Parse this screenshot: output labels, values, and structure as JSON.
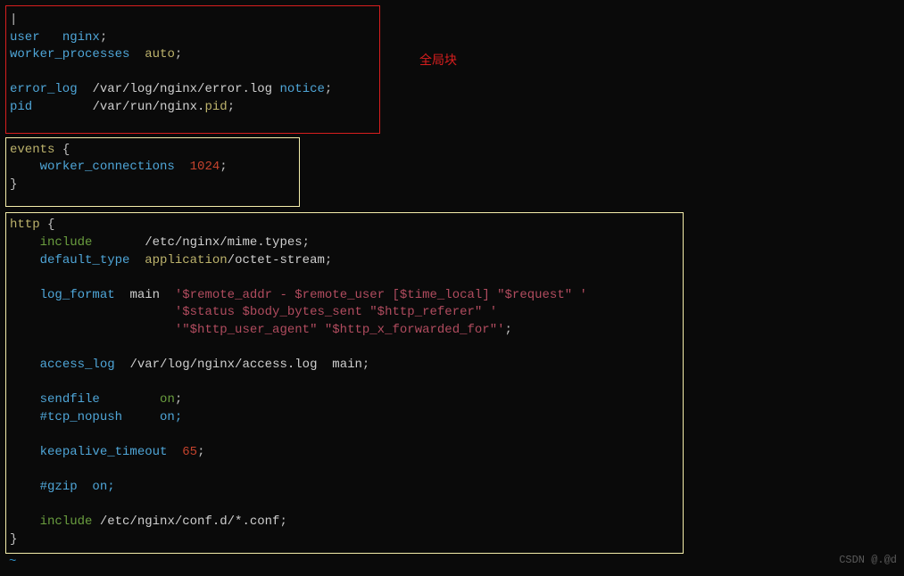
{
  "annotation": {
    "global_block": "全局块"
  },
  "global": {
    "l1_kw1": "user",
    "l1_kw2": "nginx",
    "l2_kw": "worker_processes",
    "l2_val": "auto",
    "l3_kw": "error_log",
    "l3_path": "/var/log/nginx/error.log",
    "l3_lvl": "notice",
    "l4_kw": "pid",
    "l4_path": "/var/run/nginx.",
    "l4_ext": "pid"
  },
  "events": {
    "kw": "events",
    "wc_kw": "worker_connections",
    "wc_val": "1024"
  },
  "http": {
    "kw": "http",
    "include_kw": "include",
    "include_path": "/etc/nginx/mime.types",
    "default_type_kw": "default_type",
    "default_type_app": "application",
    "default_type_val": "/octet-stream",
    "log_format_kw": "log_format",
    "log_format_name": "main",
    "lf1": "'$remote_addr - $remote_user [$time_local] \"$request\" '",
    "lf2": "'$status $body_bytes_sent \"$http_referer\" '",
    "lf3": "'\"$http_user_agent\" \"$http_x_forwarded_for\"'",
    "access_log_kw": "access_log",
    "access_log_path": "/var/log/nginx/access.log",
    "access_log_name": "main",
    "sendfile_kw": "sendfile",
    "sendfile_val": "on",
    "tcp_nopush": "#tcp_nopush     on;",
    "keepalive_kw": "keepalive_timeout",
    "keepalive_val": "65",
    "gzip": "#gzip  on;",
    "include2_kw": "include",
    "include2_path": "/etc/nginx/conf.d/*.conf"
  },
  "footer": {
    "tilde": "~",
    "watermark": "CSDN @.@d"
  }
}
